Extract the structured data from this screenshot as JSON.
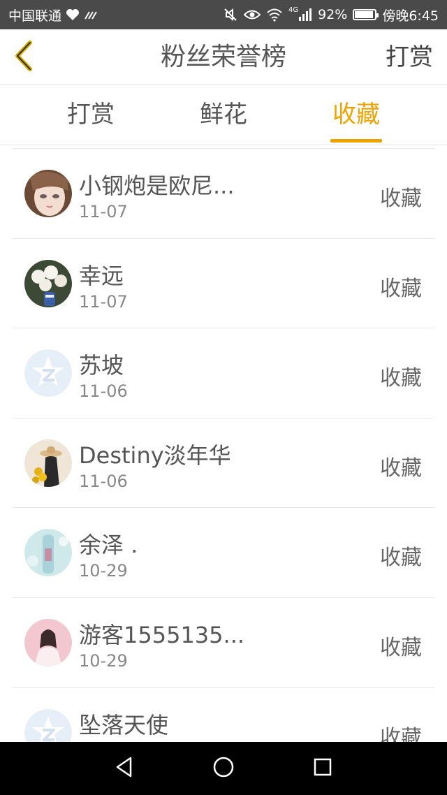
{
  "status_bar": {
    "carrier": "中国联通",
    "battery_percent": "92%",
    "battery_level": 0.92,
    "time": "傍晚6:45",
    "network": "4G"
  },
  "header": {
    "title": "粉丝荣誉榜",
    "right_action": "打赏"
  },
  "tabs": [
    {
      "label": "打赏",
      "active": false
    },
    {
      "label": "鲜花",
      "active": false
    },
    {
      "label": "收藏",
      "active": true
    }
  ],
  "list": [
    {
      "name": "小钢炮是欧尼...",
      "date": "11-07",
      "action": "收藏",
      "avatar": "doll-face"
    },
    {
      "name": "幸远",
      "date": "11-07",
      "action": "收藏",
      "avatar": "flowers-vase"
    },
    {
      "name": "苏坡",
      "date": "11-06",
      "action": "收藏",
      "avatar": "default-star"
    },
    {
      "name": "Destiny淡年华",
      "date": "11-06",
      "action": "收藏",
      "avatar": "girl-sunflower"
    },
    {
      "name": "余泽 .",
      "date": "10-29",
      "action": "收藏",
      "avatar": "bottle-photo"
    },
    {
      "name": "游客1555135...",
      "date": "10-29",
      "action": "收藏",
      "avatar": "pink-girl"
    },
    {
      "name": "坠落天使",
      "date": "",
      "action": "收藏",
      "avatar": "default-star"
    }
  ],
  "colors": {
    "accent": "#f0a200",
    "status_bar_bg": "#4a4a4a",
    "nav_bar_bg": "#000000"
  }
}
